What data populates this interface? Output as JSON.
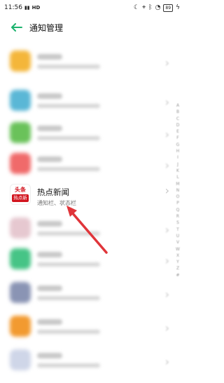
{
  "status_bar": {
    "time": "11:56",
    "network": "HD",
    "battery": "89"
  },
  "header": {
    "title": "通知管理"
  },
  "highlighted_app": {
    "name": "热点新闻",
    "subtitle": "通知栏、状态栏",
    "icon_top": "头条",
    "icon_bottom": "热点新闻"
  },
  "blurred_rows": [
    {
      "icon_color": "#f4b63a"
    },
    {
      "icon_color": "#5ab7d6"
    },
    {
      "icon_color": "#6ac25a"
    },
    {
      "icon_color": "#f06a6a"
    }
  ],
  "blurred_rows_after": [
    {
      "icon_color": "#e6c8d0"
    },
    {
      "icon_color": "#46c486"
    },
    {
      "icon_color": "#8a94b4"
    },
    {
      "icon_color": "#f29a30"
    },
    {
      "icon_color": "#cfd6e8"
    }
  ],
  "alphabet_index": [
    "A",
    "B",
    "C",
    "D",
    "E",
    "F",
    "G",
    "H",
    "I",
    "J",
    "K",
    "L",
    "M",
    "N",
    "O",
    "P",
    "Q",
    "R",
    "S",
    "T",
    "U",
    "V",
    "W",
    "X",
    "Y",
    "Z",
    "#"
  ],
  "colors": {
    "accent": "#1db36e",
    "arrow": "#e0353a",
    "brand_red": "#d2141e"
  }
}
